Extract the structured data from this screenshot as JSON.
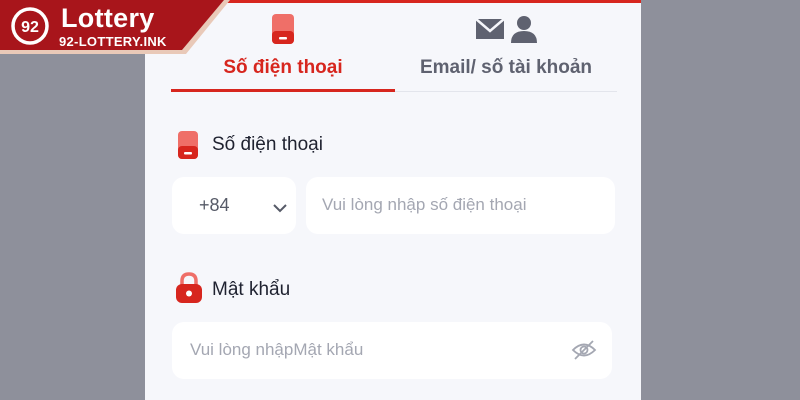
{
  "brand": {
    "logo_text": "Lottery",
    "logo_domain": "92-LOTTERY.INK",
    "logo_mark": "92",
    "accent_color": "#d7261e"
  },
  "tabs": [
    {
      "label": "Số điện thoại",
      "icon": "phone-icon",
      "active": true
    },
    {
      "label": "Email/ số tài khoản",
      "icon": "email-user-icon",
      "active": false
    }
  ],
  "phone_section": {
    "label": "Số điện thoại",
    "icon": "phone-icon",
    "country_code": "+84",
    "placeholder": "Vui lòng nhập số điện thoại"
  },
  "password_section": {
    "label": "Mật khẩu",
    "icon": "lock-icon",
    "placeholder": "Vui lòng nhậpMật khẩu",
    "visibility_icon": "eye-off-icon"
  }
}
